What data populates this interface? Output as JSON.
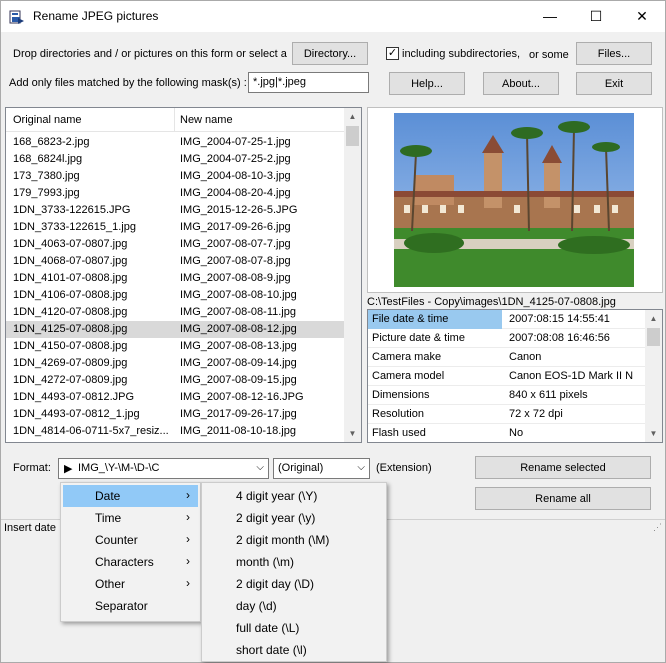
{
  "window": {
    "title": "Rename JPEG pictures",
    "minimize": "—",
    "maximize": "☐",
    "close": "✕"
  },
  "toolbar": {
    "drop_text": "Drop directories and / or pictures on this form or select a",
    "directory_button": "Directory...",
    "include_subdirs": "including subdirectories,",
    "include_subdirs_checked": true,
    "or_some": "or some",
    "files_button": "Files...",
    "mask_label": "Add only files matched by the following mask(s) :",
    "mask_value": "*.jpg|*.jpeg",
    "help_button": "Help...",
    "about_button": "About...",
    "exit_button": "Exit"
  },
  "file_list": {
    "col_original": "Original name",
    "col_new": "New name",
    "selected_index": 11,
    "rows": [
      [
        "168_6823-2.jpg",
        "IMG_2004-07-25-1.jpg"
      ],
      [
        "168_6824l.jpg",
        "IMG_2004-07-25-2.jpg"
      ],
      [
        "173_7380.jpg",
        "IMG_2004-08-10-3.jpg"
      ],
      [
        "179_7993.jpg",
        "IMG_2004-08-20-4.jpg"
      ],
      [
        "1DN_3733-122615.JPG",
        "IMG_2015-12-26-5.JPG"
      ],
      [
        "1DN_3733-122615_1.jpg",
        "IMG_2017-09-26-6.jpg"
      ],
      [
        "1DN_4063-07-0807.jpg",
        "IMG_2007-08-07-7.jpg"
      ],
      [
        "1DN_4068-07-0807.jpg",
        "IMG_2007-08-07-8.jpg"
      ],
      [
        "1DN_4101-07-0808.jpg",
        "IMG_2007-08-08-9.jpg"
      ],
      [
        "1DN_4106-07-0808.jpg",
        "IMG_2007-08-08-10.jpg"
      ],
      [
        "1DN_4120-07-0808.jpg",
        "IMG_2007-08-08-11.jpg"
      ],
      [
        "1DN_4125-07-0808.jpg",
        "IMG_2007-08-08-12.jpg"
      ],
      [
        "1DN_4150-07-0808.jpg",
        "IMG_2007-08-08-13.jpg"
      ],
      [
        "1DN_4269-07-0809.jpg",
        "IMG_2007-08-09-14.jpg"
      ],
      [
        "1DN_4272-07-0809.jpg",
        "IMG_2007-08-09-15.jpg"
      ],
      [
        "1DN_4493-07-0812.JPG",
        "IMG_2007-08-12-16.JPG"
      ],
      [
        "1DN_4493-07-0812_1.jpg",
        "IMG_2017-09-26-17.jpg"
      ],
      [
        "1DN_4814-06-0711-5x7_resiz...",
        "IMG_2011-08-10-18.jpg"
      ]
    ]
  },
  "preview": {
    "path": "C:\\TestFiles - Copy\\images\\1DN_4125-07-0808.jpg"
  },
  "properties": {
    "rows": [
      [
        "File date & time",
        "2007:08:15 14:55:41"
      ],
      [
        "Picture date & time",
        "2007:08:08 16:46:56"
      ],
      [
        "Camera make",
        "Canon"
      ],
      [
        "Camera model",
        "Canon EOS-1D Mark II N"
      ],
      [
        "Dimensions",
        "840 x 611 pixels"
      ],
      [
        "Resolution",
        "72 x 72 dpi"
      ],
      [
        "Flash used",
        "No"
      ]
    ]
  },
  "format": {
    "label": "Format:",
    "value": "IMG_\\Y-\\M-\\D-\\C",
    "case_value": "(Original)",
    "extension_label": "(Extension)",
    "rename_selected": "Rename selected",
    "rename_all": "Rename all"
  },
  "status": {
    "text": "Insert date"
  },
  "context_menu": {
    "items": [
      "Date",
      "Time",
      "Counter",
      "Characters",
      "Other",
      "Separator"
    ],
    "has_submenu": [
      true,
      true,
      true,
      true,
      true,
      false
    ],
    "highlighted": 0
  },
  "date_submenu": {
    "items": [
      "4 digit year (\\Y)",
      "2 digit year (\\y)",
      "2 digit month (\\M)",
      "month (\\m)",
      "2 digit day (\\D)",
      "day (\\d)",
      "full date (\\L)",
      "short date (\\l)"
    ]
  },
  "colors": {
    "selection": "#99c9ef",
    "menu_highlight": "#91c9f7",
    "list_selection": "#d9d9d9"
  }
}
